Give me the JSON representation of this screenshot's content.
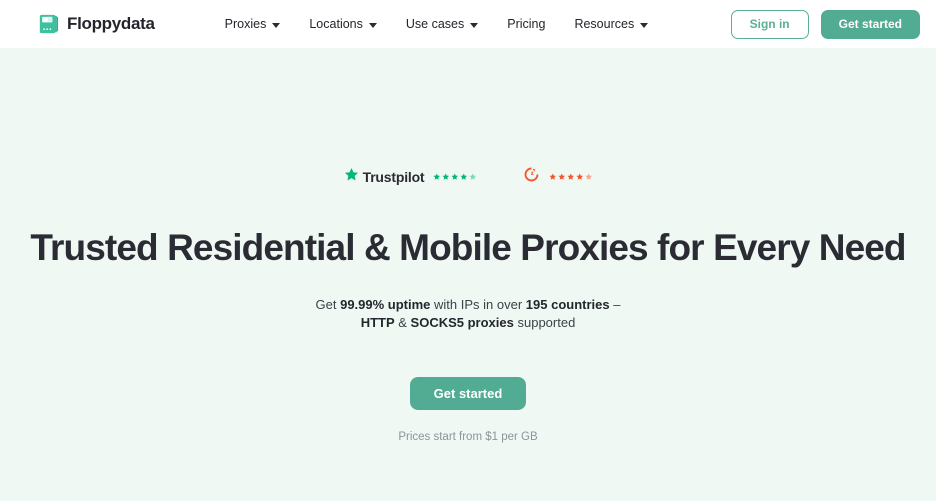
{
  "header": {
    "brand": {
      "name": "Floppydata",
      "icon": "floppy-disk-icon"
    },
    "nav": [
      {
        "label": "Proxies",
        "has_dropdown": true
      },
      {
        "label": "Locations",
        "has_dropdown": true
      },
      {
        "label": "Use cases",
        "has_dropdown": true
      },
      {
        "label": "Pricing",
        "has_dropdown": false
      },
      {
        "label": "Resources",
        "has_dropdown": true
      }
    ],
    "sign_in_label": "Sign in",
    "get_started_label": "Get started"
  },
  "hero": {
    "badges": [
      {
        "name": "Trustpilot",
        "logo": "trustpilot-star-icon",
        "stars": 5,
        "star_color": "#00b67a"
      },
      {
        "name": "G2",
        "logo": "g2-logo-icon",
        "stars": 5,
        "star_color": "#f2562f"
      }
    ],
    "headline": "Trusted Residential & Mobile Proxies for Every Need",
    "subhead": {
      "line1_a": "Get ",
      "line1_b": "99.99% uptime",
      "line1_c": " with IPs in over ",
      "line1_d": "195 countries",
      "line1_e": " –",
      "line2_a": "HTTP",
      "line2_b": " & ",
      "line2_c": "SOCKS5 proxies",
      "line2_d": " supported"
    },
    "cta_label": "Get started",
    "price_note": "Prices start from $1 per GB"
  },
  "colors": {
    "accent_teal": "#52ab93",
    "hero_background": "#f0f8f4",
    "header_background": "#ffffff",
    "trustpilot_green": "#00b67a",
    "g2_red": "#f2562f",
    "text_dark": "#2b2b33",
    "text_muted": "#8d939c"
  }
}
